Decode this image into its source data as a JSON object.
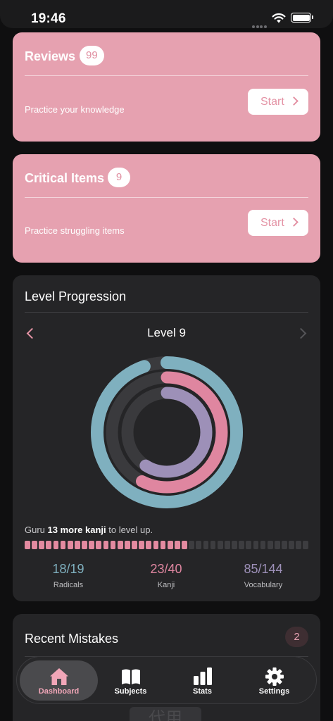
{
  "status_bar": {
    "time": "19:46"
  },
  "reviews": {
    "title": "Reviews",
    "count": "99",
    "subtitle": "Practice your knowledge",
    "button": "Start"
  },
  "critical": {
    "title": "Critical Items",
    "count": "9",
    "subtitle": "Practice struggling items",
    "button": "Start"
  },
  "level_progression": {
    "title": "Level Progression",
    "level_label": "Level 9",
    "guru_prefix": "Guru ",
    "guru_bold": "13 more kanji",
    "guru_suffix": " to level up.",
    "progress": {
      "segments": 40,
      "filled": 23
    },
    "stats": [
      {
        "value": "18/19",
        "label": "Radicals",
        "color": "#7fb0bf",
        "fraction": 0.947
      },
      {
        "value": "23/40",
        "label": "Kanji",
        "color": "#df86a0",
        "fraction": 0.575
      },
      {
        "value": "85/144",
        "label": "Vocabulary",
        "color": "#9d90b8",
        "fraction": 0.59
      }
    ]
  },
  "recent_mistakes": {
    "title": "Recent Mistakes",
    "count": "2",
    "peek_text": "代用"
  },
  "tabbar": {
    "tabs": [
      {
        "label": "Dashboard",
        "icon": "house-icon",
        "active": true
      },
      {
        "label": "Subjects",
        "icon": "book-icon",
        "active": false
      },
      {
        "label": "Stats",
        "icon": "bar-chart-icon",
        "active": false
      },
      {
        "label": "Settings",
        "icon": "gear-icon",
        "active": false
      }
    ]
  },
  "colors": {
    "accent_pink": "#e6a1b0",
    "card_dark": "#252527",
    "background": "#0f0f10"
  }
}
